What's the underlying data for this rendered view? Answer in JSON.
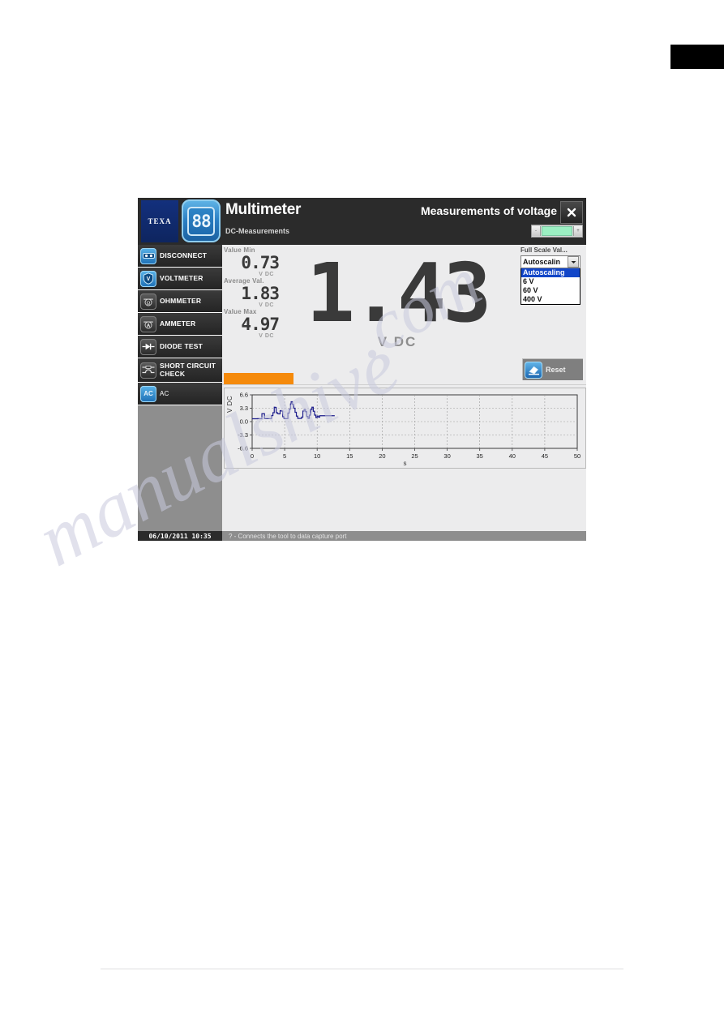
{
  "window": {
    "title": "Multimeter",
    "subtitle": "DC-Measurements",
    "mode": "Measurements of voltage",
    "close_icon": "close-icon",
    "logo_text": "TEXA",
    "device_glyph": "88"
  },
  "sidebar": {
    "items": [
      {
        "label": "DISCONNECT",
        "icon": "connector-icon",
        "style": "blue"
      },
      {
        "label": "VOLTMETER",
        "icon": "voltmeter-icon",
        "style": "blue"
      },
      {
        "label": "OHMMETER",
        "icon": "ohmmeter-icon",
        "style": "dark"
      },
      {
        "label": "AMMETER",
        "icon": "ammeter-icon",
        "style": "dark"
      },
      {
        "label": "DIODE TEST",
        "icon": "diode-icon",
        "style": "dark"
      },
      {
        "label": "SHORT CIRCUIT CHECK",
        "icon": "short-circuit-icon",
        "style": "dark"
      },
      {
        "label": "AC",
        "icon": "ac-icon",
        "style": "blue",
        "glyph": "AC"
      }
    ]
  },
  "readouts": [
    {
      "label": "Value Min",
      "value": "0.73",
      "unit": "V DC"
    },
    {
      "label": "Average Val.",
      "value": "1.83",
      "unit": "V DC"
    },
    {
      "label": "Value Max",
      "value": "4.97",
      "unit": "V DC"
    }
  ],
  "main_display": {
    "value": "1.43",
    "unit": "V DC"
  },
  "full_scale": {
    "label": "Full Scale Val...",
    "selected": "Autoscalin",
    "options": [
      "Autoscaling",
      "6 V",
      "60 V",
      "400 V"
    ],
    "selected_index": 0,
    "highlight_color": "#1246c8"
  },
  "reset_button": {
    "label": "Reset",
    "icon": "eraser-icon"
  },
  "level_indicator": {
    "fill_color": "#9beec2",
    "minus": "-",
    "plus": "+"
  },
  "statusbar": {
    "datetime": "06/10/2011 10:35",
    "hint": "? - Connects the tool to data capture port"
  },
  "watermark": {
    "line1": "manualshive",
    "line2": ".com"
  },
  "chart_data": {
    "type": "line",
    "title": "",
    "xlabel": "s",
    "ylabel": "V DC",
    "xlim": [
      0,
      50
    ],
    "ylim": [
      -6.6,
      6.6
    ],
    "xticks": [
      0,
      5,
      10,
      15,
      20,
      25,
      30,
      35,
      40,
      45,
      50
    ],
    "yticks": [
      6.6,
      3.3,
      0.0,
      -3.3,
      -6.6
    ],
    "ytick_labels": [
      "6.6",
      "3.3",
      "0.0",
      "-3.3",
      "-6.6"
    ],
    "grid": true,
    "legend": false,
    "line_color": "#1d1d8c",
    "series": [
      {
        "name": "V DC",
        "x": [
          0.0,
          0.4,
          0.8,
          1.2,
          1.5,
          1.7,
          1.9,
          2.1,
          2.4,
          2.7,
          3.0,
          3.2,
          3.4,
          3.5,
          3.7,
          3.9,
          4.1,
          4.3,
          4.5,
          4.7,
          4.9,
          5.1,
          5.3,
          5.5,
          5.7,
          5.9,
          6.0,
          6.2,
          6.4,
          6.6,
          6.8,
          7.0,
          7.2,
          7.4,
          7.6,
          7.8,
          8.0,
          8.2,
          8.4,
          8.6,
          8.8,
          9.0,
          9.2,
          9.4,
          9.6,
          9.8,
          10.0,
          10.2,
          10.4,
          10.6,
          10.9,
          11.3,
          11.8,
          12.3,
          12.7
        ],
        "y": [
          0.7,
          0.7,
          0.72,
          0.7,
          1.95,
          1.95,
          0.72,
          0.72,
          0.74,
          0.74,
          1.5,
          2.2,
          3.55,
          3.5,
          2.2,
          1.95,
          1.9,
          2.7,
          2.6,
          1.2,
          0.75,
          0.72,
          0.74,
          2.1,
          3.1,
          4.35,
          4.9,
          4.2,
          3.3,
          2.3,
          1.35,
          0.8,
          0.76,
          0.78,
          1.1,
          2.6,
          2.95,
          2.45,
          1.25,
          0.8,
          1.6,
          3.0,
          3.55,
          2.55,
          1.6,
          1.0,
          1.35,
          1.1,
          1.45,
          1.45,
          1.45,
          1.45,
          1.45,
          1.45,
          1.45
        ]
      }
    ]
  }
}
